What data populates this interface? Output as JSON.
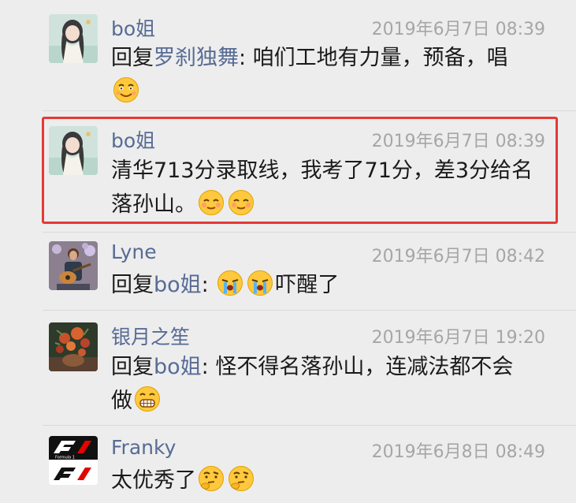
{
  "comments": [
    {
      "name": "bo姐",
      "time": "2019年6月7日 08:39",
      "reply_prefix": "回复",
      "mention": "罗刹独舞",
      "colon": ": ",
      "text_line1": "咱们工地有力量，预备，唱",
      "emojis": [
        "grin-emoji"
      ],
      "avatar": "anime-girl-avatar"
    },
    {
      "name": "bo姐",
      "time": "2019年6月7日 08:39",
      "text_line1": "清华713分录取线，我考了71分，差3分给名",
      "text_line2": "落孙山。",
      "emojis": [
        "blush-emoji",
        "blush-emoji"
      ],
      "avatar": "anime-girl-avatar",
      "highlighted": true
    },
    {
      "name": "Lyne",
      "time": "2019年6月7日 08:42",
      "reply_prefix": "回复",
      "mention": "bo姐",
      "colon": ": ",
      "text_after": "吓醒了",
      "emojis": [
        "crying-emoji",
        "crying-emoji"
      ],
      "avatar": "guitar-player-avatar"
    },
    {
      "name": "银月之笙",
      "time": "2019年6月7日 19:20",
      "reply_prefix": "回复",
      "mention": "bo姐",
      "colon": ": ",
      "text_line1": "怪不得名落孙山，连减法都不会",
      "text_line2": "做",
      "emojis": [
        "grimace-emoji"
      ],
      "avatar": "flower-painting-avatar"
    },
    {
      "name": "Franky",
      "time": "2019年6月8日 08:49",
      "text_line1": "太优秀了",
      "emojis": [
        "thinking-emoji",
        "thinking-emoji"
      ],
      "avatar": "f1-logo-avatar"
    }
  ],
  "f1_logo_text": "F1",
  "f1_logo_subtext": "Formula 1",
  "colors": {
    "background": "#ededed",
    "name": "#576b95",
    "time": "#a6a6a6",
    "text": "#1a1a1a",
    "highlight_border": "#e53935",
    "emoji_yellow": "#ffc83d"
  }
}
